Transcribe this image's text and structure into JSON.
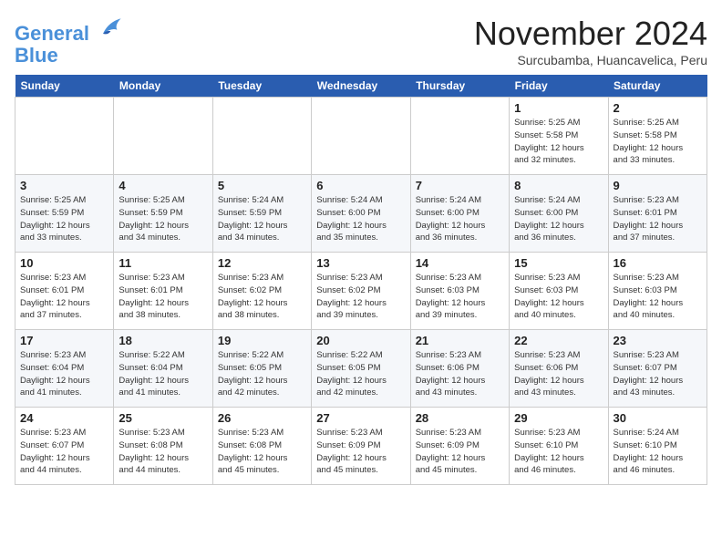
{
  "logo": {
    "line1": "General",
    "line2": "Blue"
  },
  "title": "November 2024",
  "location": "Surcubamba, Huancavelica, Peru",
  "weekdays": [
    "Sunday",
    "Monday",
    "Tuesday",
    "Wednesday",
    "Thursday",
    "Friday",
    "Saturday"
  ],
  "weeks": [
    [
      {
        "day": "",
        "info": ""
      },
      {
        "day": "",
        "info": ""
      },
      {
        "day": "",
        "info": ""
      },
      {
        "day": "",
        "info": ""
      },
      {
        "day": "",
        "info": ""
      },
      {
        "day": "1",
        "info": "Sunrise: 5:25 AM\nSunset: 5:58 PM\nDaylight: 12 hours\nand 32 minutes."
      },
      {
        "day": "2",
        "info": "Sunrise: 5:25 AM\nSunset: 5:58 PM\nDaylight: 12 hours\nand 33 minutes."
      }
    ],
    [
      {
        "day": "3",
        "info": "Sunrise: 5:25 AM\nSunset: 5:59 PM\nDaylight: 12 hours\nand 33 minutes."
      },
      {
        "day": "4",
        "info": "Sunrise: 5:25 AM\nSunset: 5:59 PM\nDaylight: 12 hours\nand 34 minutes."
      },
      {
        "day": "5",
        "info": "Sunrise: 5:24 AM\nSunset: 5:59 PM\nDaylight: 12 hours\nand 34 minutes."
      },
      {
        "day": "6",
        "info": "Sunrise: 5:24 AM\nSunset: 6:00 PM\nDaylight: 12 hours\nand 35 minutes."
      },
      {
        "day": "7",
        "info": "Sunrise: 5:24 AM\nSunset: 6:00 PM\nDaylight: 12 hours\nand 36 minutes."
      },
      {
        "day": "8",
        "info": "Sunrise: 5:24 AM\nSunset: 6:00 PM\nDaylight: 12 hours\nand 36 minutes."
      },
      {
        "day": "9",
        "info": "Sunrise: 5:23 AM\nSunset: 6:01 PM\nDaylight: 12 hours\nand 37 minutes."
      }
    ],
    [
      {
        "day": "10",
        "info": "Sunrise: 5:23 AM\nSunset: 6:01 PM\nDaylight: 12 hours\nand 37 minutes."
      },
      {
        "day": "11",
        "info": "Sunrise: 5:23 AM\nSunset: 6:01 PM\nDaylight: 12 hours\nand 38 minutes."
      },
      {
        "day": "12",
        "info": "Sunrise: 5:23 AM\nSunset: 6:02 PM\nDaylight: 12 hours\nand 38 minutes."
      },
      {
        "day": "13",
        "info": "Sunrise: 5:23 AM\nSunset: 6:02 PM\nDaylight: 12 hours\nand 39 minutes."
      },
      {
        "day": "14",
        "info": "Sunrise: 5:23 AM\nSunset: 6:03 PM\nDaylight: 12 hours\nand 39 minutes."
      },
      {
        "day": "15",
        "info": "Sunrise: 5:23 AM\nSunset: 6:03 PM\nDaylight: 12 hours\nand 40 minutes."
      },
      {
        "day": "16",
        "info": "Sunrise: 5:23 AM\nSunset: 6:03 PM\nDaylight: 12 hours\nand 40 minutes."
      }
    ],
    [
      {
        "day": "17",
        "info": "Sunrise: 5:23 AM\nSunset: 6:04 PM\nDaylight: 12 hours\nand 41 minutes."
      },
      {
        "day": "18",
        "info": "Sunrise: 5:22 AM\nSunset: 6:04 PM\nDaylight: 12 hours\nand 41 minutes."
      },
      {
        "day": "19",
        "info": "Sunrise: 5:22 AM\nSunset: 6:05 PM\nDaylight: 12 hours\nand 42 minutes."
      },
      {
        "day": "20",
        "info": "Sunrise: 5:22 AM\nSunset: 6:05 PM\nDaylight: 12 hours\nand 42 minutes."
      },
      {
        "day": "21",
        "info": "Sunrise: 5:23 AM\nSunset: 6:06 PM\nDaylight: 12 hours\nand 43 minutes."
      },
      {
        "day": "22",
        "info": "Sunrise: 5:23 AM\nSunset: 6:06 PM\nDaylight: 12 hours\nand 43 minutes."
      },
      {
        "day": "23",
        "info": "Sunrise: 5:23 AM\nSunset: 6:07 PM\nDaylight: 12 hours\nand 43 minutes."
      }
    ],
    [
      {
        "day": "24",
        "info": "Sunrise: 5:23 AM\nSunset: 6:07 PM\nDaylight: 12 hours\nand 44 minutes."
      },
      {
        "day": "25",
        "info": "Sunrise: 5:23 AM\nSunset: 6:08 PM\nDaylight: 12 hours\nand 44 minutes."
      },
      {
        "day": "26",
        "info": "Sunrise: 5:23 AM\nSunset: 6:08 PM\nDaylight: 12 hours\nand 45 minutes."
      },
      {
        "day": "27",
        "info": "Sunrise: 5:23 AM\nSunset: 6:09 PM\nDaylight: 12 hours\nand 45 minutes."
      },
      {
        "day": "28",
        "info": "Sunrise: 5:23 AM\nSunset: 6:09 PM\nDaylight: 12 hours\nand 45 minutes."
      },
      {
        "day": "29",
        "info": "Sunrise: 5:23 AM\nSunset: 6:10 PM\nDaylight: 12 hours\nand 46 minutes."
      },
      {
        "day": "30",
        "info": "Sunrise: 5:24 AM\nSunset: 6:10 PM\nDaylight: 12 hours\nand 46 minutes."
      }
    ]
  ]
}
